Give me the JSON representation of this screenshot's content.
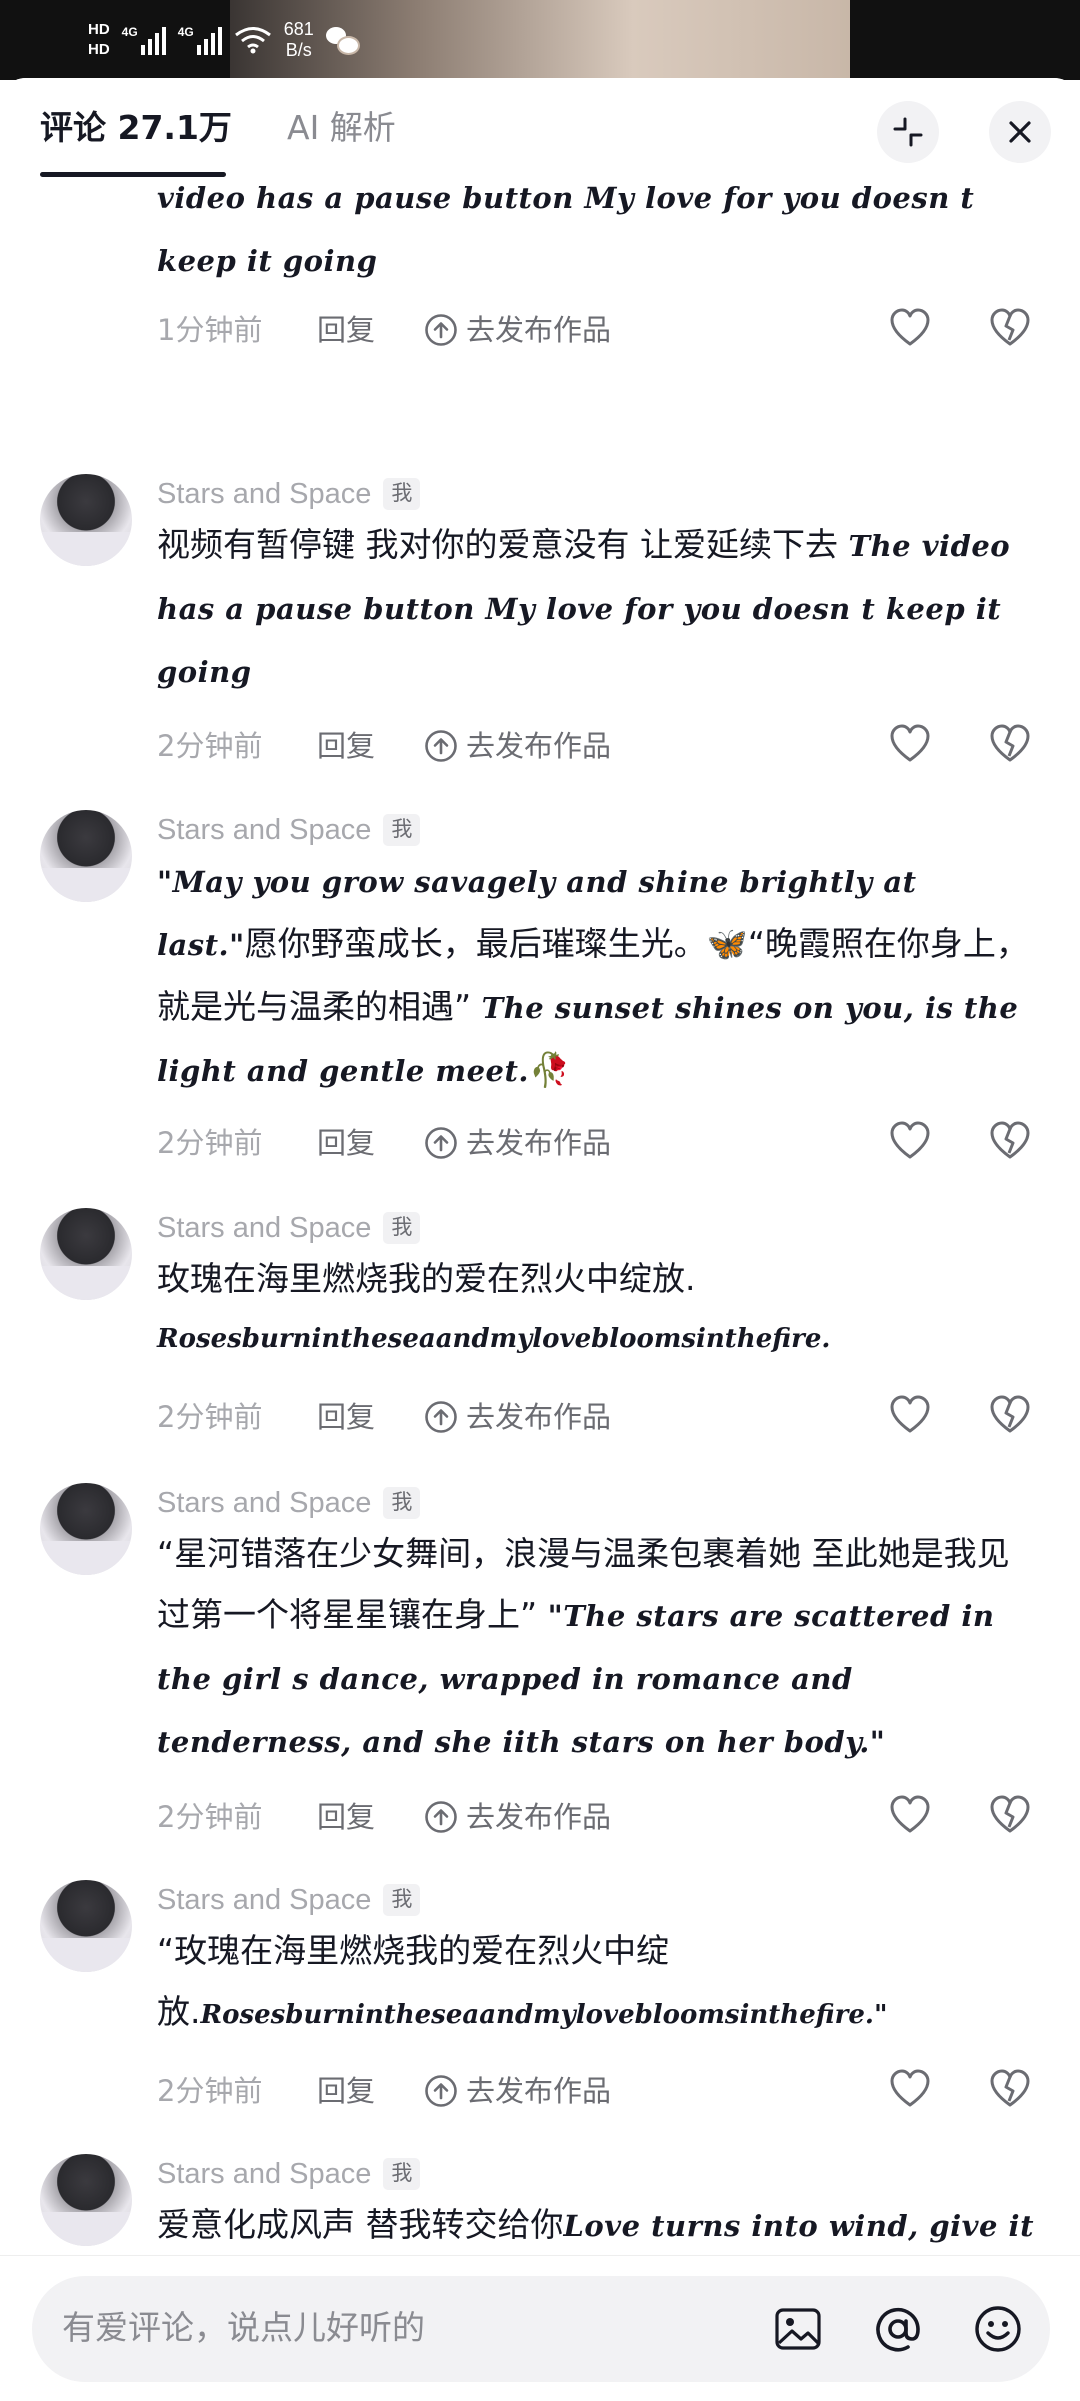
{
  "status_bar": {
    "network": [
      "HD",
      "HD"
    ],
    "signal_labels": [
      "4G",
      "4G"
    ],
    "speed_value": "681",
    "speed_unit": "B/s"
  },
  "tabs": {
    "comments_label": "评论 27.1万",
    "ai_label": "AI 解析"
  },
  "comments": [
    {
      "author": "",
      "badge": "",
      "text_cn": "",
      "text_en": "video has a pause button  My love for you doesn t keep it going",
      "time": "1分钟前",
      "reply": "回复",
      "publish": "去发布作品"
    },
    {
      "author": "Stars and Space",
      "badge": "我",
      "text_cn": "视频有暂停键 我对你的爱意没有 让爱延续下去 ",
      "text_en": "The video has a pause button  My love for you doesn t keep it going",
      "time": "2分钟前",
      "reply": "回复",
      "publish": "去发布作品"
    },
    {
      "author": "Stars and Space",
      "badge": "我",
      "text_en_pre": "\"May you grow savagely and shine brightly at last.\"",
      "text_cn": "愿你野蛮成长，最后璀璨生光。🦋“晚霞照在你身上，就是光与温柔的相遇” ",
      "text_en": "The sunset shines on you, is the light and gentle meet.",
      "emoji_end": "🥀",
      "time": "2分钟前",
      "reply": "回复",
      "publish": "去发布作品"
    },
    {
      "author": "Stars and Space",
      "badge": "我",
      "text_cn": "玫瑰在海里燃烧我的爱在烈火中绽放.",
      "text_en": "Rosesburnintheseaandmylovebloomsinthefire.",
      "time": "2分钟前",
      "reply": "回复",
      "publish": "去发布作品"
    },
    {
      "author": "Stars and Space",
      "badge": "我",
      "text_cn": "“星河错落在少女舞间，浪漫与温柔包裹着她 至此她是我见过第一个将星星镶在身上” ",
      "text_en": "\"The stars are scattered in the girl s dance, wrapped in romance and tenderness, and she iith stars on her body.\"",
      "time": "2分钟前",
      "reply": "回复",
      "publish": "去发布作品"
    },
    {
      "author": "Stars and Space",
      "badge": "我",
      "text_cn": "“玫瑰在海里燃烧我的爱在烈火中绽放.",
      "text_en": "Rosesburnintheseaandmylovebloomsinthefire.\"",
      "time": "2分钟前",
      "reply": "回复",
      "publish": "去发布作品"
    },
    {
      "author": "Stars and Space",
      "badge": "我",
      "text_cn": "爱意化成风声  替我转交给你",
      "text_en": "Love turns into wind, give it to you for me.",
      "time": "",
      "reply": "",
      "publish": ""
    }
  ],
  "input": {
    "placeholder": "有爱评论，说点儿好听的"
  },
  "icons": {
    "collapse": "collapse-icon",
    "close": "close-icon",
    "like": "heart-icon",
    "dislike": "broken-heart-icon",
    "publish": "upload-circle-icon",
    "image": "image-icon",
    "mention": "at-icon",
    "emoji": "smiley-icon"
  },
  "colors": {
    "text_primary": "#161823",
    "text_secondary": "#a7a8ad",
    "action_gray": "#6b6c72",
    "pill_bg": "#f2f2f4"
  }
}
